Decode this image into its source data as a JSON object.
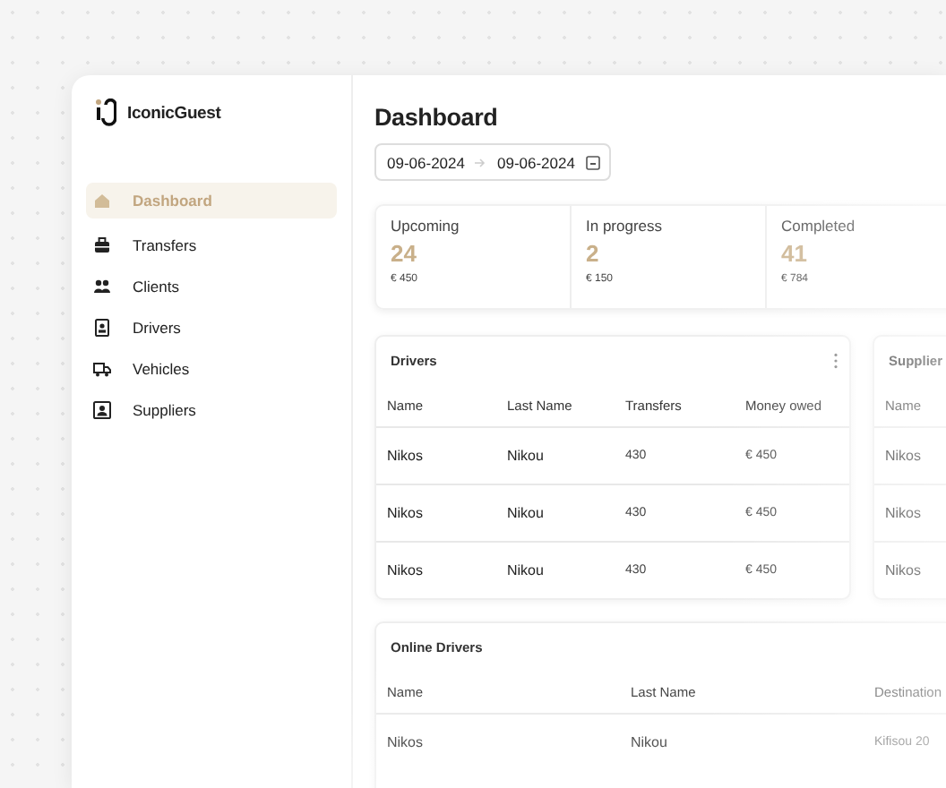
{
  "app": {
    "logo": "IconicGuest"
  },
  "sidebar": {
    "items": [
      {
        "label": "Dashboard",
        "selected": true
      },
      {
        "label": "Transfers",
        "selected": false
      },
      {
        "label": "Clients",
        "selected": false
      },
      {
        "label": "Drivers",
        "selected": false
      },
      {
        "label": "Vehicles",
        "selected": false
      },
      {
        "label": "Suppliers",
        "selected": false
      }
    ]
  },
  "dashboard": {
    "title": "Dashboard",
    "date_range": {
      "start": "09-06-2024",
      "end": "09-06-2024"
    },
    "stats": [
      {
        "label": "Upcoming",
        "count": "24",
        "amount": "€ 450"
      },
      {
        "label": "In progress",
        "count": "2",
        "amount": "€ 150"
      },
      {
        "label": "Completed",
        "count": "41",
        "amount": "€ 784"
      }
    ]
  },
  "drivers_table": {
    "title": "Drivers",
    "columns": [
      "Name",
      "Last Name",
      "Transfers",
      "Money owed"
    ],
    "rows": [
      [
        "Nikos",
        "Nikou",
        "430",
        "€ 450"
      ],
      [
        "Nikos",
        "Nikou",
        "430",
        "€ 450"
      ],
      [
        "Nikos",
        "Nikou",
        "430",
        "€ 450"
      ]
    ]
  },
  "suppliers_table": {
    "title": "Supplier",
    "columns": [
      "Name"
    ],
    "rows": [
      [
        "Nikos"
      ],
      [
        "Nikos"
      ],
      [
        "Nikos"
      ]
    ]
  },
  "online_drivers_table": {
    "title": "Online Drivers",
    "columns": [
      "Name",
      "Last Name",
      "Destination"
    ],
    "rows": [
      [
        "Nikos",
        "Nikou",
        "Kifisou 20"
      ]
    ]
  }
}
